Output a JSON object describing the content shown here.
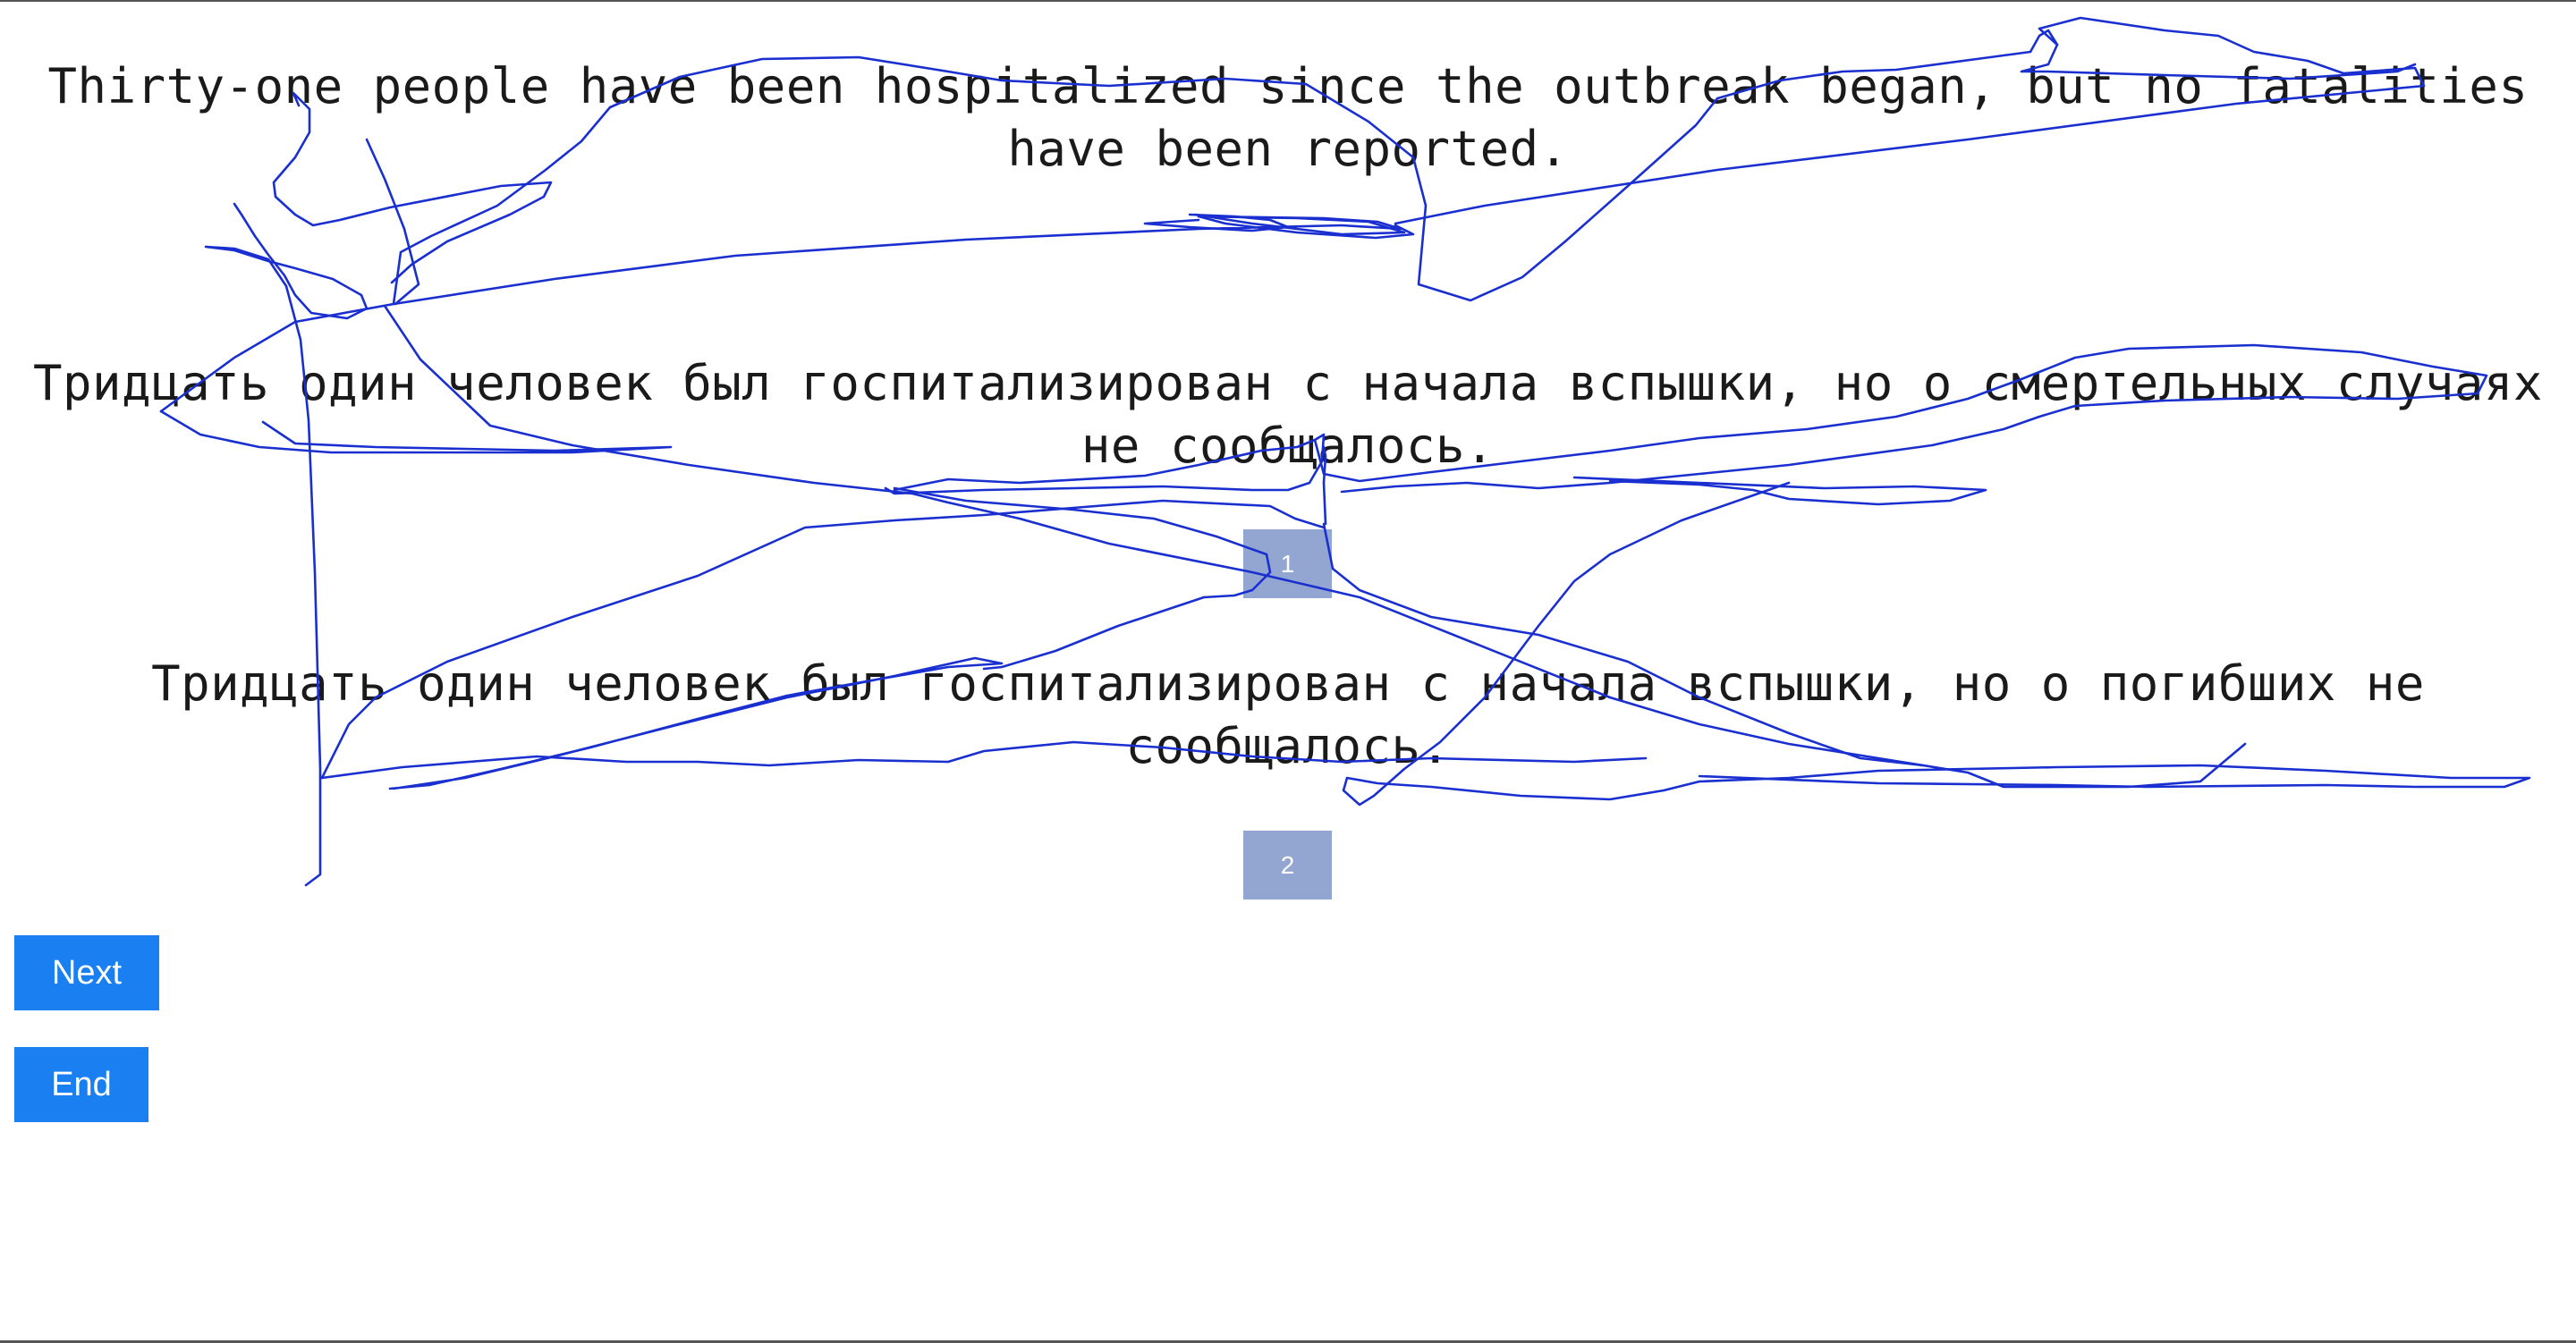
{
  "source_sentence": "Thirty-one people have been hospitalized since the outbreak began, but no fatalities have been reported.",
  "translations": [
    {
      "text": "Тридцать один человек был госпитализирован с начала вспышки, но о смертельных случаях не сообщалось.",
      "badge": "1"
    },
    {
      "text": "Тридцать один человек был госпитализирован с начала вспышки, но о погибших не сообщалось.",
      "badge": "2"
    }
  ],
  "buttons": {
    "next_label": "Next",
    "end_label": "End"
  },
  "colors": {
    "badge_bg": "#93a6d1",
    "button_bg": "#1a7ff0",
    "scribble_stroke": "#1a2fd0"
  }
}
